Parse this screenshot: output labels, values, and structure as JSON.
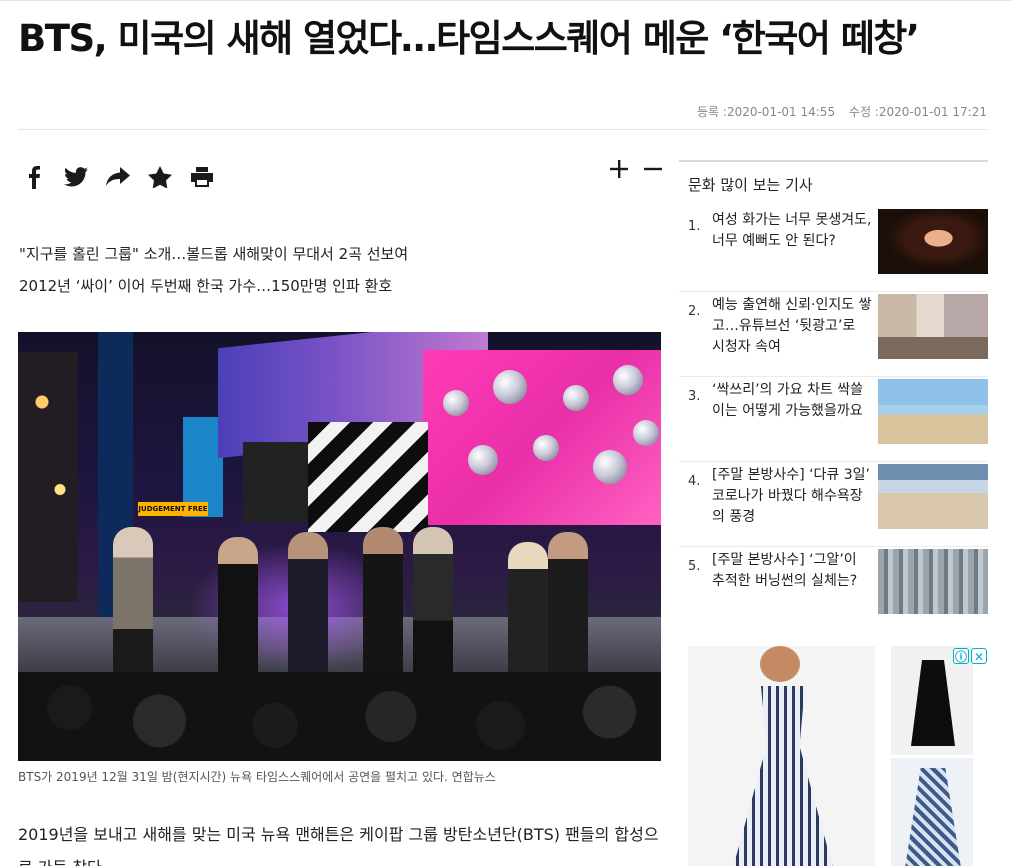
{
  "article": {
    "headline": "BTS, 미국의 새해 열었다…타임스스퀘어 메운 ‘한국어 떼창’",
    "registered_label": "등록 :",
    "registered_time": "2020-01-01 14:55",
    "modified_label": "수정 :",
    "modified_time": "2020-01-01 17:21",
    "subheads": [
      "\"지구를 홀린 그룹\" 소개…볼드롭 새해맞이 무대서 2곡 선보여",
      "2012년 ‘싸이’ 이어 두번째 한국 가수…150만명 인파 환호"
    ],
    "photo_caption": "BTS가 2019년 12월 31일 밤(현지시간) 뉴욕 타임스스퀘어에서 공연을 펼치고 있다. 연합뉴스",
    "photo_sign_text": "JUDGEMENT FREE",
    "body_first_line": "2019년을 보내고 새해를 맞는 미국 뉴욕 맨해튼은 케이팝 그룹 방탄소년단(BTS) 팬들의 합성으",
    "body_second_line": "로 가득 찼다."
  },
  "share_icons": [
    "facebook-icon",
    "twitter-icon",
    "share-icon",
    "star-icon",
    "print-icon"
  ],
  "font_controls": [
    "plus-icon",
    "minus-icon"
  ],
  "sidebar": {
    "title": "문화 많이 보는 기사",
    "items": [
      {
        "num": "1.",
        "title": "여성 화가는 너무 못생겨도, 너무 예뻐도 안 된다?"
      },
      {
        "num": "2.",
        "title": "예능 출연해 신뢰·인지도 쌓고…유튜브선 ‘뒷광고’로 시청자 속여"
      },
      {
        "num": "3.",
        "title": "‘싹쓰리’의 가요 차트 싹쓸이는 어떻게 가능했을까요"
      },
      {
        "num": "4.",
        "title": "[주말 본방사수] ‘다큐 3일’ 코로나가 바꿨다 해수욕장의 풍경"
      },
      {
        "num": "5.",
        "title": "[주말 본방사수] ‘그알’이 추적한 버닝썬의 실체는?"
      }
    ]
  },
  "ad": {
    "choices": [
      "ⓘ",
      "✕"
    ]
  }
}
